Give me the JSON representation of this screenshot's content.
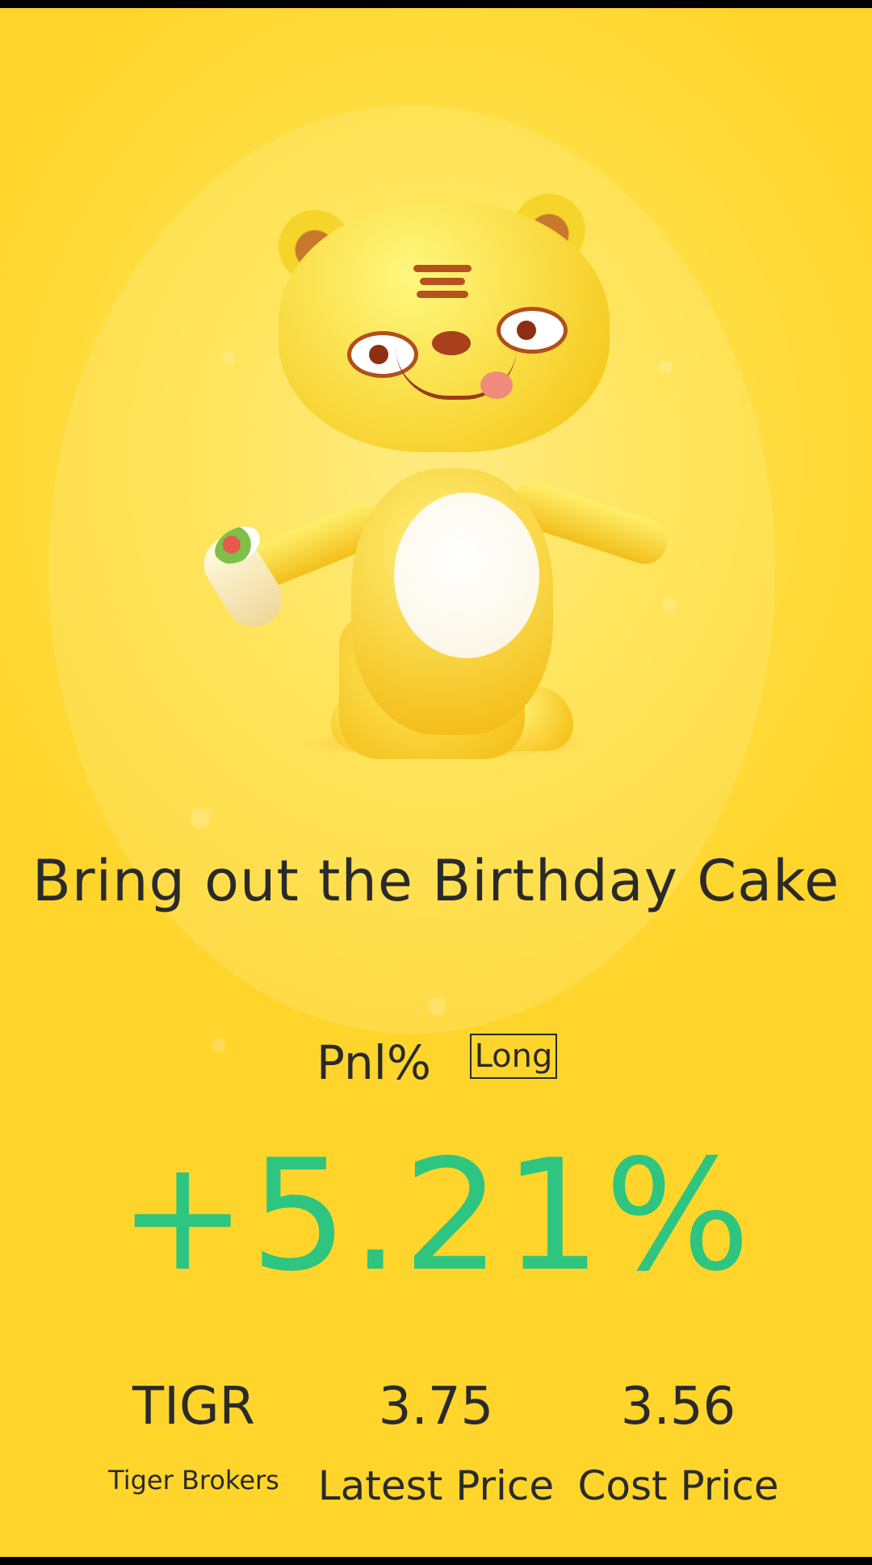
{
  "theme": {
    "background": "#ffd83a",
    "positive_color": "#2dc57f",
    "text_color": "#2a2a2a"
  },
  "mascot": {
    "icon": "tiger-mascot-icon"
  },
  "title": "Bring out the Birthday Cake",
  "pnl": {
    "label": "Pnl%",
    "position_badge": "Long",
    "value": "+5.21%"
  },
  "stats": {
    "ticker": {
      "value": "TIGR",
      "label": "Tiger Brokers"
    },
    "latest_price": {
      "value": "3.75",
      "label": "Latest Price"
    },
    "cost_price": {
      "value": "3.56",
      "label": "Cost Price"
    }
  }
}
